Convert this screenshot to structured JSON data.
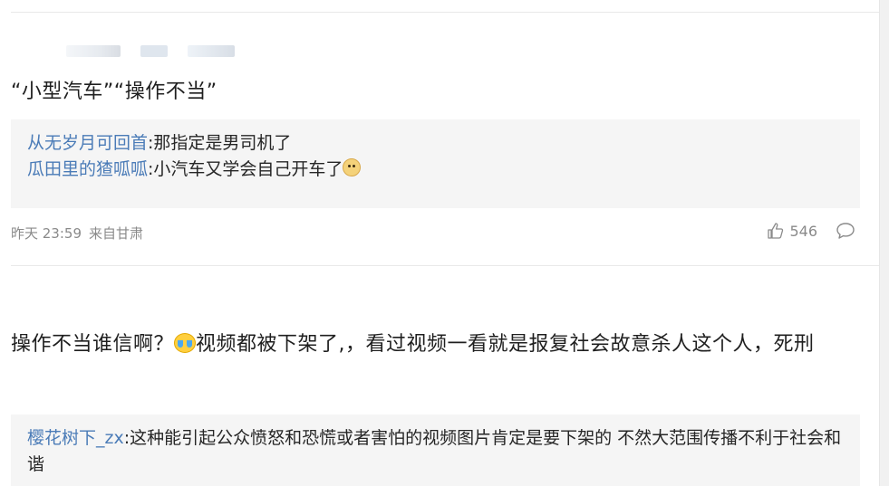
{
  "comment1": {
    "text": "“小型汽车”“操作不当”",
    "replies": [
      {
        "name": "从无岁月可回首",
        "text": ":那指定是男司机了",
        "emoji": null
      },
      {
        "name": "瓜田里的猹呱呱",
        "text": ":小汽车又学会自己开车了",
        "emoji": "doge-emoji"
      }
    ],
    "time": "昨天 23:59",
    "source": "来自甘肃",
    "likes": "546"
  },
  "comment2": {
    "text_before": "操作不当谁信啊？",
    "text_after": "视频都被下架了,，看过视频一看就是报复社会故意杀人这个人，死刑",
    "emoji": "crying-laughing-emoji",
    "replies": [
      {
        "name": "樱花树下_zx",
        "text": ":这种能引起公众愤怒和恐慌或者害怕的视频图片肯定是要下架的 不然大范围传播不利于社会和谐"
      }
    ]
  },
  "colors": {
    "link": "#4a7bb7",
    "quote_bg": "#f5f5f5",
    "meta": "#8a8a8a"
  }
}
